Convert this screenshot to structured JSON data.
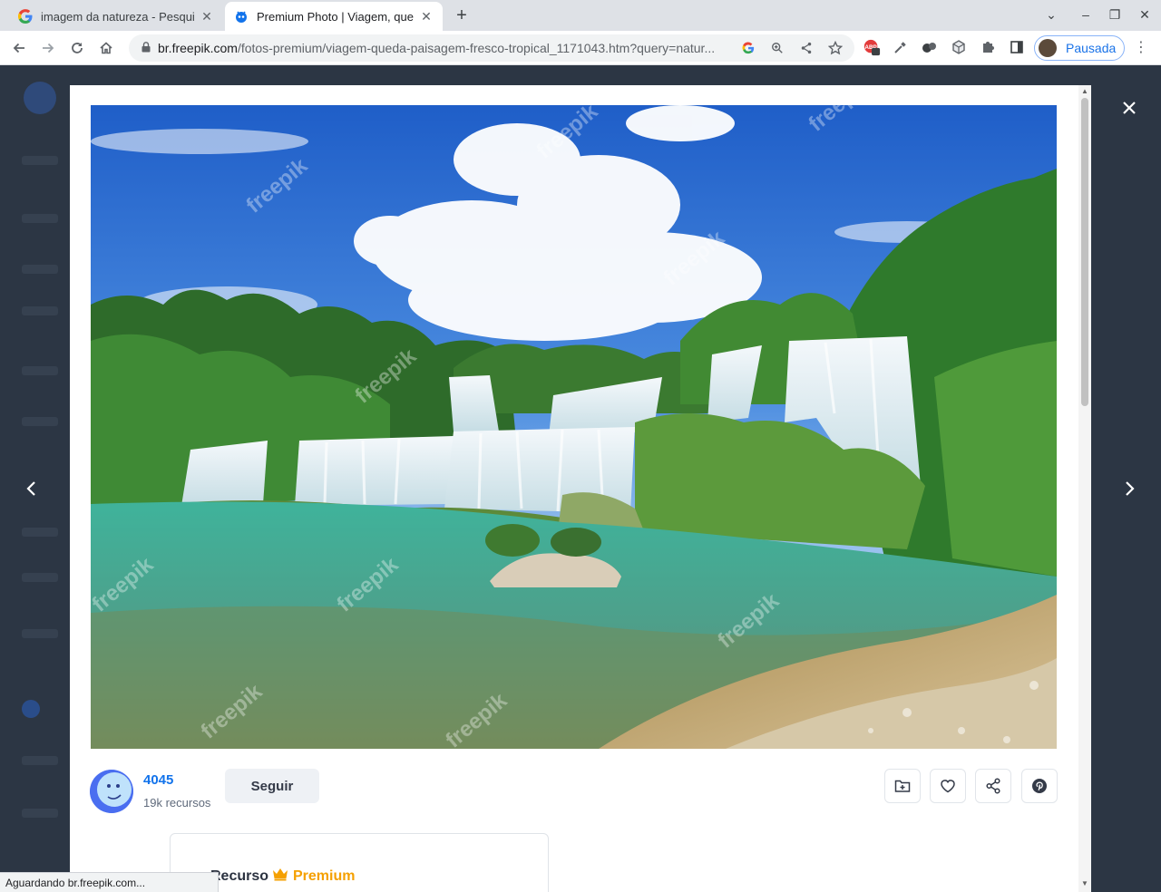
{
  "browser": {
    "tabs": [
      {
        "title": "imagem da natureza - Pesquis",
        "favicon": "google-g-icon",
        "close": "✕"
      },
      {
        "title": "Premium Photo | Viagem, que",
        "favicon": "freepik-icon",
        "close": "✕"
      }
    ],
    "new_tab": "+",
    "url_host": "br.freepik.com",
    "url_path": "/fotos-premium/viagem-queda-paisagem-fresco-tropical_1171043.htm?query=natur...",
    "profile_label": "Pausada",
    "extension_badge": "2"
  },
  "modal": {
    "close_label": "✕",
    "author": {
      "name": "4045",
      "resources": "19k recursos"
    },
    "follow_label": "Seguir",
    "actions": [
      "add-to-collection-icon",
      "heart-icon",
      "share-icon",
      "pinterest-icon"
    ],
    "premium_card": {
      "prefix": "Recurso",
      "label": "Premium"
    },
    "watermark": "freepik"
  },
  "status_text": "Aguardando br.freepik.com...",
  "colors": {
    "accent_blue": "#1273eb",
    "premium_gold": "#f5a000",
    "overlay": "#2c3644"
  }
}
